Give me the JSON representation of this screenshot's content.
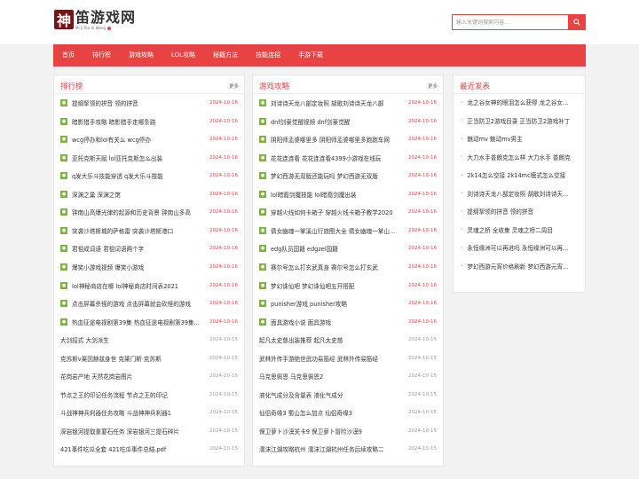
{
  "logo": {
    "mark": "神",
    "text": "笛游戏网",
    "sub": "Mi Ji You Xi Wang"
  },
  "search": {
    "placeholder": "输入关键词搜索内容...",
    "icon": "search-icon"
  },
  "colors": {
    "accent": "#e84242",
    "badge": "#7cb342",
    "date_grey": "#999999"
  },
  "nav": [
    "首页",
    "排行榜",
    "游戏攻略",
    "LOL攻略",
    "秘籍方法",
    "技能连招",
    "手游下载"
  ],
  "rank": {
    "title": "排行榜",
    "more": "更多",
    "items": [
      {
        "badge": "●",
        "title": "提纲挈领的拼音 领的拼音",
        "date": "2024-10-16",
        "hot": true
      },
      {
        "badge": "●",
        "title": "暗影猎手攻略 暗影猎手走哪条路",
        "date": "2024-10-16",
        "hot": true
      },
      {
        "badge": "●",
        "title": "wcg停办和lol有关么 wcg停办",
        "date": "2024-10-16",
        "hot": true
      },
      {
        "badge": "●",
        "title": "亚托克斯天赋 lol亚托克斯怎么出装",
        "date": "2024-10-16",
        "hot": true
      },
      {
        "badge": "●",
        "title": "q发大乐斗技能穿透 q发大乐斗技能",
        "date": "2024-10-16",
        "hot": true
      },
      {
        "badge": "●",
        "title": "深渊之巢 深渊之馆",
        "date": "2024-10-16",
        "hot": true
      },
      {
        "badge": "●",
        "title": "钟南山高爆光律的起源和历史背景 钟南山多高",
        "date": "2024-10-16",
        "hot": true
      },
      {
        "badge": "●",
        "title": "突袭沙塔斯城的萨格雷 突袭沙塔斯港口",
        "date": "2024-10-16",
        "hot": true
      },
      {
        "badge": "●",
        "title": "君祖成词语 君祖词语两个字",
        "date": "2024-10-16",
        "hot": true
      },
      {
        "badge": "●",
        "title": "爆笑小游戏视频 爆笑小游戏",
        "date": "2024-10-16",
        "hot": true
      },
      {
        "badge": "●",
        "title": "lol神秘商店在哪 lol神秘商店时间表2021",
        "date": "2024-10-16",
        "hot": true
      },
      {
        "badge": "●",
        "title": "点击屏幕杀怪的游戏 点击屏幕就会砍怪的游戏",
        "date": "2024-10-16",
        "hot": true
      },
      {
        "badge": "●",
        "title": "热血征途电视剧第39集 热血征途电视剧第39集...",
        "date": "2024-10-16",
        "hot": true
      },
      {
        "badge": "",
        "title": "大剑招式 大剑派生",
        "date": "2024-10-15",
        "hot": false
      },
      {
        "badge": "",
        "title": "克苏斯v莱因赫兹身世 克莱门斯·克苏斯",
        "date": "2024-10-15",
        "hot": false
      },
      {
        "badge": "",
        "title": "花岗岩产地 天然花岗岩图片",
        "date": "2024-10-15",
        "hot": false
      },
      {
        "badge": "",
        "title": "节点之王的印记任务流程 节点之王的印记",
        "date": "2024-10-15",
        "hot": false
      },
      {
        "badge": "",
        "title": "斗战神神兵利器任务攻略 斗战神神兵利器1",
        "date": "2024-10-15",
        "hot": false
      },
      {
        "badge": "",
        "title": "深岩银河提取重要石任务 深岩银河三提石碎片",
        "date": "2024-10-15",
        "hot": false
      },
      {
        "badge": "",
        "title": "421事件吃瓜全套 421吃瓜事件总结.pdf",
        "date": "2024-10-15",
        "hot": false
      }
    ]
  },
  "guides": {
    "title": "游戏攻略",
    "more": "更多",
    "items": [
      {
        "badge": "●",
        "title": "刘诗诗天龙八部定妆照 胡歌刘诗诗天龙八部",
        "date": "2024-10-16",
        "hot": true
      },
      {
        "badge": "●",
        "title": "dnf剑豪觉醒视频 dnf剑豪觉醒",
        "date": "2024-10-16",
        "hot": true
      },
      {
        "badge": "●",
        "title": "阴阳师孟婆哪里多 阴阳师孟婆哪里多跑跑车网",
        "date": "2024-10-16",
        "hot": true
      },
      {
        "badge": "●",
        "title": "花花连连看 花花连连看4399小游戏在线玩",
        "date": "2024-10-16",
        "hot": true
      },
      {
        "badge": "●",
        "title": "梦幻西游无双版还能玩吗 梦幻西游无双版",
        "date": "2024-10-16",
        "hot": true
      },
      {
        "badge": "●",
        "title": "lol暗裔剑魔技能 lol暗裔剑魔出装",
        "date": "2024-10-16",
        "hot": true
      },
      {
        "badge": "●",
        "title": "穿越火线如何卡箱子 穿越火线卡箱子教学2020",
        "date": "2024-10-16",
        "hot": true
      },
      {
        "badge": "●",
        "title": "倩女幽魂一掌溪山行旅图大全 倩女幽魂一掌山...",
        "date": "2024-10-16",
        "hot": true
      },
      {
        "badge": "●",
        "title": "edg队员国籍 edgzel国籍",
        "date": "2024-10-16",
        "hot": true
      },
      {
        "badge": "●",
        "title": "赛尔号怎么打玄武真身 赛尔号怎么打玄武",
        "date": "2024-10-16",
        "hot": true
      },
      {
        "badge": "●",
        "title": "梦幻诛仙吧 梦幻诛仙吧五开搭配",
        "date": "2024-10-16",
        "hot": true
      },
      {
        "badge": "●",
        "title": "punisher游戏 punisher攻略",
        "date": "2024-10-16",
        "hot": true
      },
      {
        "badge": "●",
        "title": "面具游戏小说 面具游戏",
        "date": "2024-10-16",
        "hot": true
      },
      {
        "badge": "",
        "title": "起凡太史慈出装推荐 起凡太史慈",
        "date": "2024-10-15",
        "hot": false
      },
      {
        "badge": "",
        "title": "武林外传手游绝世武功易筋经 武林外传易筋经",
        "date": "2024-10-15",
        "hot": false
      },
      {
        "badge": "",
        "title": "马克思佩恩 马克思佩恩2",
        "date": "2024-10-15",
        "hot": false
      },
      {
        "badge": "",
        "title": "液化气成分及含量表 液化气成分",
        "date": "2024-10-15",
        "hot": false
      },
      {
        "badge": "",
        "title": "仙侣奇缘3 蜀山怎么加点 仙侣奇缘3",
        "date": "2024-10-15",
        "hot": false
      },
      {
        "badge": "",
        "title": "保卫萝卜沙漠关卡9 保卫萝卜冒险沙漠9",
        "date": "2024-10-15",
        "hot": false
      },
      {
        "badge": "",
        "title": "濡沫江湖攻略杭州 濡沫江湖杭州任务后续攻略二",
        "date": "2024-10-15",
        "hot": false
      }
    ]
  },
  "latest": {
    "title": "最近发表",
    "items": [
      "龙之谷女神的眼泪怎么获得 龙之谷女...",
      "正当防卫2游戏目录 正当防卫2游戏补丁",
      "魅动mv 魅动mv男主",
      "大力水手普朗克怎么样 大力水手 普朗克",
      "2k14怎么空接 2k14mc模式怎么空接",
      "刘诗诗天龙八部定妆照 胡歌刘诗诗天...",
      "提纲挈领的拼音 领的拼音",
      "灵魂之桥 全收集 灵魂之桥二周目",
      "永恒缘洲可以再进吗 永恒缘洲可以再...",
      "梦幻西游元宵价格刷新 梦幻西游元宵..."
    ]
  }
}
